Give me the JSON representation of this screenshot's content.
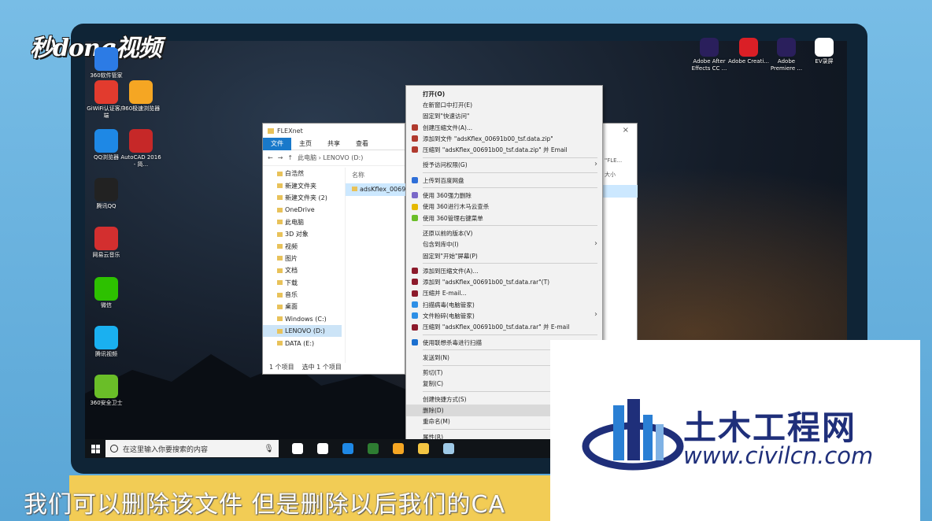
{
  "brand": {
    "logo_text": "秒dong视频"
  },
  "desktop_icons_left": [
    {
      "label": "360软件管家",
      "icon": "360-software-manager-icon",
      "color": "#2c7be5"
    },
    {
      "label": "GiWiFi认证客户端",
      "icon": "giwifi-icon",
      "color": "#e23b2e"
    },
    {
      "label": "360极速浏览器",
      "icon": "360-browser-icon",
      "color": "#f5a623"
    },
    {
      "label": "QQ浏览器",
      "icon": "qq-browser-icon",
      "color": "#1e88e5"
    },
    {
      "label": "AutoCAD 2016 - 简...",
      "icon": "autocad-icon",
      "color": "#c62828"
    },
    {
      "label": "腾讯QQ",
      "icon": "qq-penguin-icon",
      "color": "#222222"
    },
    {
      "label": "网易云音乐",
      "icon": "netease-music-icon",
      "color": "#d32f2f"
    },
    {
      "label": "微信",
      "icon": "wechat-icon",
      "color": "#2dc100"
    },
    {
      "label": "腾讯视频",
      "icon": "tencent-video-icon",
      "color": "#1ab0f0"
    },
    {
      "label": "360安全卫士",
      "icon": "360-security-icon",
      "color": "#6abe28"
    }
  ],
  "desktop_icons_top_right": [
    {
      "label": "Adobe After Effects CC ...",
      "icon": "after-effects-icon",
      "color": "#2a1f5c"
    },
    {
      "label": "Adobe Creati...",
      "icon": "creative-cloud-icon",
      "color": "#da1f26"
    },
    {
      "label": "Adobe Premiere ...",
      "icon": "premiere-icon",
      "color": "#2a1f5c"
    },
    {
      "label": "EV录屏",
      "icon": "ev-recorder-icon",
      "color": "#ffffff"
    }
  ],
  "explorer": {
    "title": "FLEXnet",
    "ribbon_tabs": [
      "文件",
      "主页",
      "共享",
      "查看"
    ],
    "address": "此电脑 › LENOVO (D:)",
    "nav_items": [
      "白浩然",
      "新建文件夹",
      "新建文件夹 (2)",
      "OneDrive",
      "此电脑",
      "3D 对象",
      "视频",
      "图片",
      "文档",
      "下载",
      "音乐",
      "桌面",
      "Windows (C:)",
      "LENOVO (D:)",
      "DATA (E:)"
    ],
    "selected_nav": "LENOVO (D:)",
    "column_header": "名称",
    "file_row": "adsKflex_00691b",
    "status_count": "1 个项目",
    "status_selected": "选中 1 个项目",
    "search_hint": "\"FLE...",
    "size_header": "大小",
    "close_glyph": "×"
  },
  "context_menu": {
    "groups": [
      [
        {
          "label": "打开(O)",
          "bold": true
        },
        {
          "label": "在新窗口中打开(E)"
        },
        {
          "label": "固定到\"快速访问\""
        },
        {
          "label": "创建压缩文件(A)...",
          "icon_color": "#b03a2e"
        },
        {
          "label": "添加到文件 \"adsKflex_00691b00_tsf.data.zip\"",
          "icon_color": "#b03a2e"
        },
        {
          "label": "压缩到 \"adsKflex_00691b00_tsf.data.zip\" 并 Email",
          "icon_color": "#b03a2e"
        }
      ],
      [
        {
          "label": "授予访问权限(G)",
          "submenu": true
        }
      ],
      [
        {
          "label": "上传到百度网盘",
          "icon_color": "#2f6fd8"
        }
      ],
      [
        {
          "label": "使用 360强力删除",
          "icon_color": "#7a68c8"
        },
        {
          "label": "使用 360进行木马云查杀",
          "icon_color": "#e5b800"
        },
        {
          "label": "使用 360管理右键菜单",
          "icon_color": "#6abe28"
        }
      ],
      [
        {
          "label": "还原以前的版本(V)"
        },
        {
          "label": "包含到库中(I)",
          "submenu": true
        },
        {
          "label": "固定到\"开始\"屏幕(P)"
        }
      ],
      [
        {
          "label": "添加到压缩文件(A)...",
          "icon_color": "#8c1a2b"
        },
        {
          "label": "添加到 \"adsKflex_00691b00_tsf.data.rar\"(T)",
          "icon_color": "#8c1a2b"
        },
        {
          "label": "压缩并 E-mail...",
          "icon_color": "#8c1a2b"
        },
        {
          "label": "扫描病毒(电脑管家)",
          "icon_color": "#2d8fe6"
        },
        {
          "label": "文件粉碎(电脑管家)",
          "icon_color": "#2d8fe6",
          "submenu": true
        },
        {
          "label": "压缩到 \"adsKflex_00691b00_tsf.data.rar\" 并 E-mail",
          "icon_color": "#8c1a2b"
        }
      ],
      [
        {
          "label": "使用联想杀毒进行扫描",
          "icon_color": "#1b6fcf"
        }
      ],
      [
        {
          "label": "发送到(N)"
        }
      ],
      [
        {
          "label": "剪切(T)"
        },
        {
          "label": "复制(C)"
        }
      ],
      [
        {
          "label": "创建快捷方式(S)"
        },
        {
          "label": "删除(D)",
          "highlight": true
        },
        {
          "label": "重命名(M)"
        }
      ],
      [
        {
          "label": "属性(R)"
        }
      ]
    ]
  },
  "taskbar": {
    "search_placeholder": "在这里输入你要搜索的内容",
    "apps": [
      {
        "icon": "task-view-icon",
        "color": "#ffffff"
      },
      {
        "icon": "fan-icon",
        "color": "#ffffff"
      },
      {
        "icon": "edge-icon",
        "color": "#1e88e5"
      },
      {
        "icon": "screen-recorder-icon",
        "color": "#2e7d32"
      },
      {
        "icon": "360-browser-icon",
        "color": "#f5a623"
      },
      {
        "icon": "file-explorer-icon",
        "color": "#f4c542"
      },
      {
        "icon": "app-icon",
        "color": "#9ec9e6"
      }
    ]
  },
  "subtitle": "我们可以删除该文件  但是删除以后我们的CA",
  "watermark": {
    "title": "土木工程网",
    "url": "www.civilcn.com"
  }
}
